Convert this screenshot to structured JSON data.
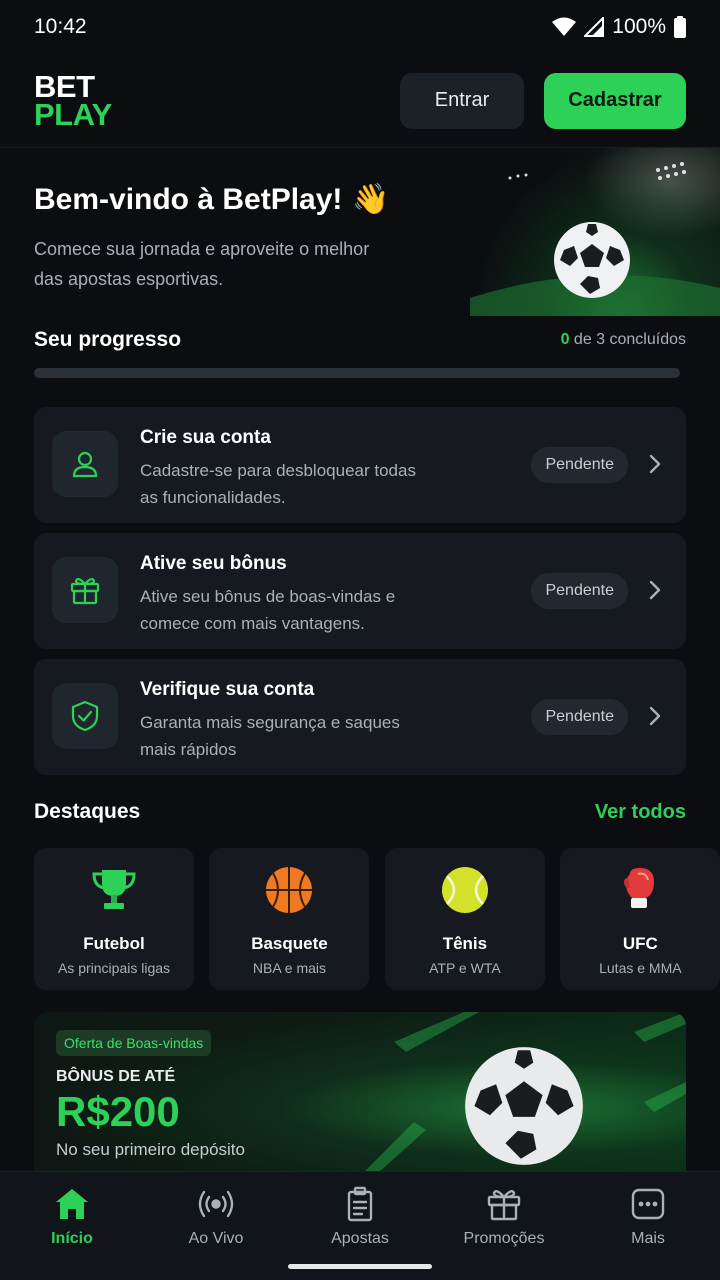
{
  "status_bar": {
    "time": "10:42",
    "battery": "100%"
  },
  "header": {
    "logo_line1": "BET",
    "logo_line2": "PLAY",
    "login_label": "Entrar",
    "signup_label": "Cadastrar"
  },
  "hero": {
    "title": "Bem-vindo à BetPlay!",
    "emoji": "👋",
    "subtitle": "Comece sua jornada e aproveite o melhor das apostas esportivas."
  },
  "progress": {
    "title": "Seu progresso",
    "done": "0",
    "suffix": "de 3 concluídos",
    "fraction": 0
  },
  "tasks": [
    {
      "title": "Crie sua conta",
      "desc": "Cadastre-se para desbloquear todas as funcionalidades.",
      "status": "Pendente",
      "icon": "user-icon"
    },
    {
      "title": "Ative seu bônus",
      "desc": "Ative seu bônus de boas-vindas e comece com mais vantagens.",
      "status": "Pendente",
      "icon": "gift-icon"
    },
    {
      "title": "Verifique sua conta",
      "desc": "Garanta mais segurança e saques mais rápidos",
      "status": "Pendente",
      "icon": "shield-check-icon"
    }
  ],
  "highlights": {
    "title": "Destaques",
    "see_all": "Ver todos",
    "items": [
      {
        "name": "Futebol",
        "sub": "As principais ligas",
        "icon": "trophy-icon"
      },
      {
        "name": "Basquete",
        "sub": "NBA e mais",
        "icon": "basketball-icon"
      },
      {
        "name": "Tênis",
        "sub": "ATP e WTA",
        "icon": "tennis-ball-icon"
      },
      {
        "name": "UFC",
        "sub": "Lutas e MMA",
        "icon": "boxing-glove-icon"
      }
    ]
  },
  "promo": {
    "tag": "Oferta de Boas-vindas",
    "label": "BÔNUS DE ATÉ",
    "amount": "R$200",
    "sub": "No seu primeiro depósito"
  },
  "nav": [
    {
      "label": "Início",
      "icon": "home-icon",
      "active": true
    },
    {
      "label": "Ao Vivo",
      "icon": "live-broadcast-icon",
      "active": false
    },
    {
      "label": "Apostas",
      "icon": "clipboard-icon",
      "active": false
    },
    {
      "label": "Promoções",
      "icon": "gift-icon",
      "active": false
    },
    {
      "label": "Mais",
      "icon": "more-icon",
      "active": false
    }
  ],
  "colors": {
    "accent": "#2ed158",
    "background": "#0b0d10",
    "card": "#161a20"
  }
}
